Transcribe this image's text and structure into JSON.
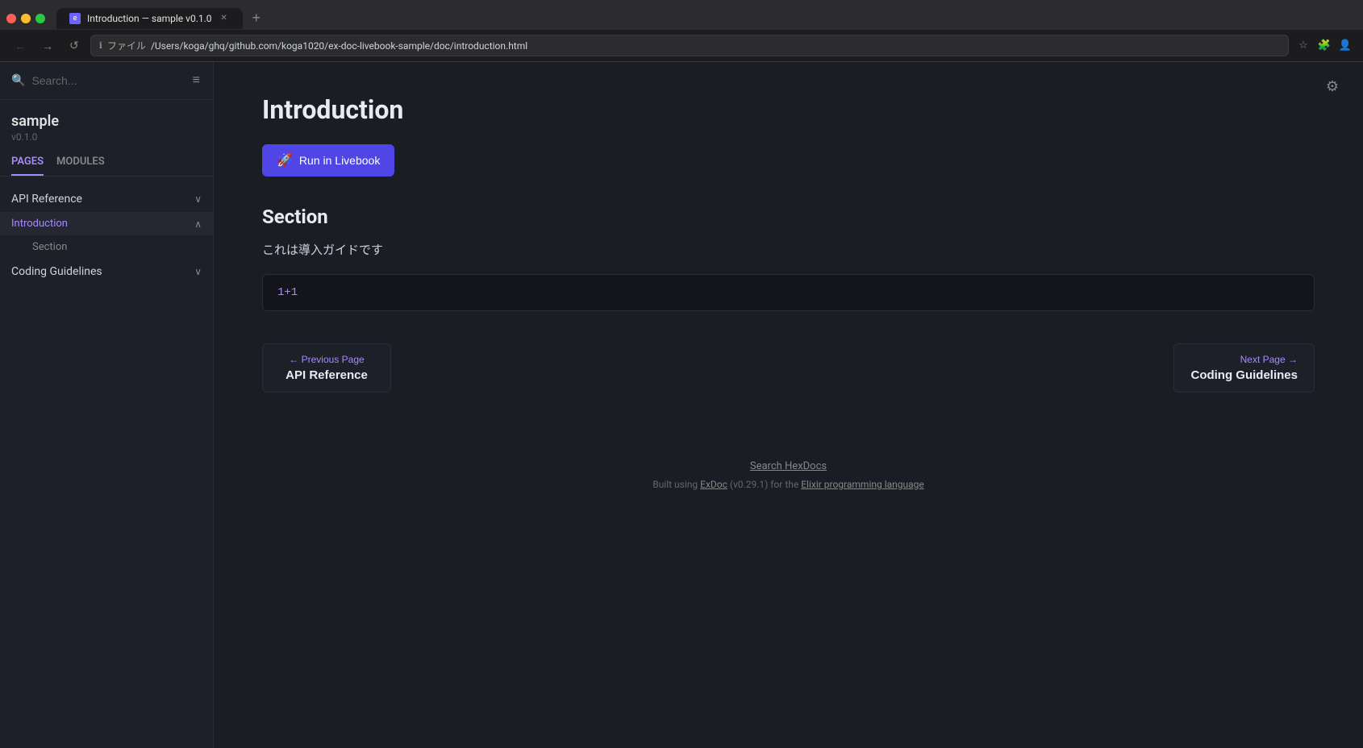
{
  "browser": {
    "tab_title": "Introduction — sample v0.1.0",
    "address": "/Users/koga/ghq/github.com/koga1020/ex-doc-livebook-sample/doc/introduction.html",
    "address_prefix": "ファイル",
    "nav_buttons": {
      "back": "←",
      "forward": "→",
      "refresh": "↺",
      "new_tab": "+"
    }
  },
  "sidebar": {
    "search_placeholder": "Search...",
    "brand_name": "sample",
    "brand_version": "v0.1.0",
    "tabs": [
      {
        "id": "pages",
        "label": "PAGES",
        "active": true
      },
      {
        "id": "modules",
        "label": "MODULES",
        "active": false
      }
    ],
    "nav_items": [
      {
        "id": "api-reference",
        "label": "API Reference",
        "type": "section",
        "collapsed": false
      },
      {
        "id": "introduction",
        "label": "Introduction",
        "type": "section",
        "active": true,
        "collapsed": false
      },
      {
        "id": "section",
        "label": "Section",
        "type": "sub"
      },
      {
        "id": "coding-guidelines",
        "label": "Coding Guidelines",
        "type": "section",
        "collapsed": false
      }
    ]
  },
  "main": {
    "page_title": "Introduction",
    "livebook_btn_label": "Run in Livebook",
    "section_heading": "Section",
    "section_text": "これは導入ガイドです",
    "code_content": "1+1",
    "prev_page": {
      "label": "← Previous Page",
      "title": "API Reference"
    },
    "next_page": {
      "label": "Next Page →",
      "title": "Coding Guidelines"
    }
  },
  "footer": {
    "hexdocs_link": "Search HexDocs",
    "built_text": "Built using ",
    "exdoc_label": "ExDoc",
    "exdoc_version": " (v0.29.1) for the ",
    "elixir_label": "Elixir programming language"
  },
  "icons": {
    "search": "🔍",
    "hamburger": "≡",
    "chevron_down": "∨",
    "chevron_up": "∧",
    "settings": "⚙",
    "livebook": "🚀"
  }
}
